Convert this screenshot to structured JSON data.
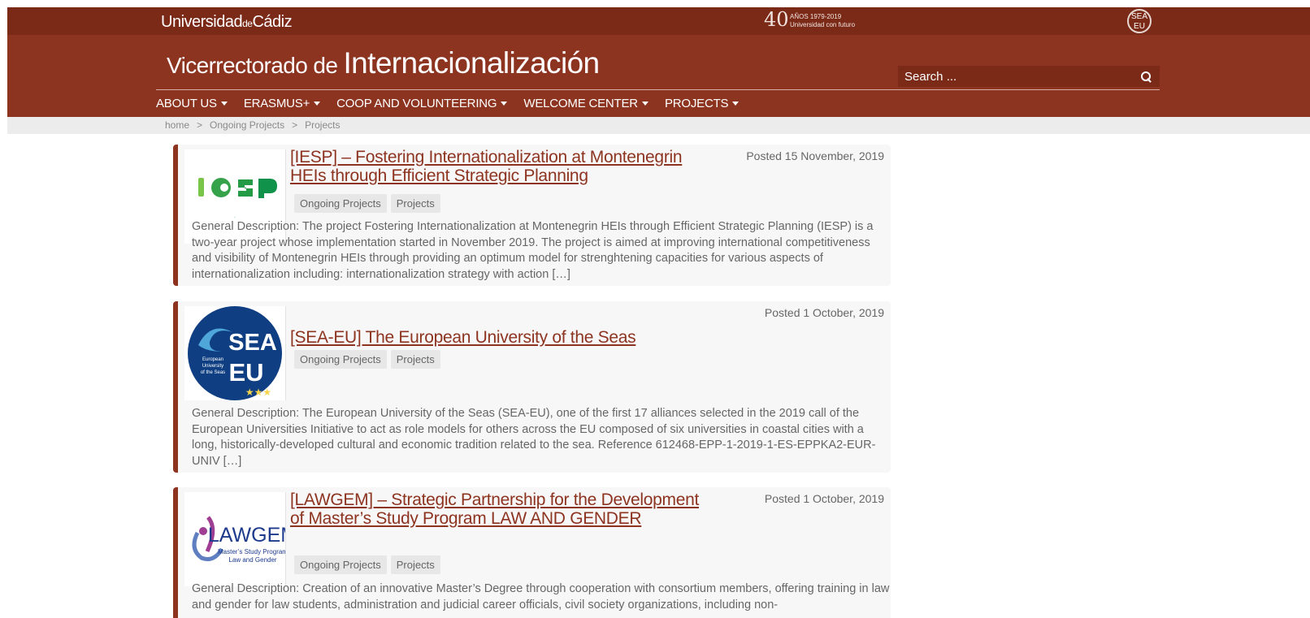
{
  "header": {
    "university_prefix": "Universidad",
    "university_small": "de",
    "university_suffix": "Cádiz",
    "anniversary_number": "40",
    "anniversary_text": "AÑOS 1979-2019 Universidad con futuro",
    "sea_eu_mini": "SEA EU",
    "site_title_small": "Vicerrectorado de ",
    "site_title_large": "Internacionalización",
    "search_placeholder": "Search ..."
  },
  "nav": {
    "items": [
      {
        "label": "ABOUT US"
      },
      {
        "label": "ERASMUS+"
      },
      {
        "label": "COOP AND VOLUNTEERING"
      },
      {
        "label": "WELCOME CENTER"
      },
      {
        "label": "PROJECTS"
      }
    ]
  },
  "breadcrumb": {
    "items": [
      {
        "label": "home"
      },
      {
        "label": "Ongoing Projects"
      },
      {
        "label": "Projects"
      }
    ],
    "separator": ">"
  },
  "posts": [
    {
      "logo_text": "IESP",
      "title": "[IESP] – Fostering Internationalization at Montenegrin HEIs through Efficient Strategic Planning",
      "date": "Posted 15 November, 2019",
      "tags": [
        "Ongoing Projects",
        "Projects"
      ],
      "description": "General Description: The project Fostering Internationalization at Montenegrin HEIs through Efficient Strategic Planning (IESP) is a two-year project whose  implementation started in November 2019. The project is aimed at improving international competitiveness and visibility of Montenegrin HEIs through providing an optimum model for strenghtening capacities for various aspects of internationalization including: internationalization strategy with action […]"
    },
    {
      "logo_text": "SEA EU",
      "logo_caption": "European University of the Seas",
      "title": "[SEA-EU] The European University of the Seas",
      "date": "Posted 1 October, 2019",
      "tags": [
        "Ongoing Projects",
        "Projects"
      ],
      "description": "General Description: The European University of the Seas (SEA-EU), one of the first 17 alliances selected in the 2019 call of the European Universities Initiative to act as role models for others across the EU composed of six universities in coastal cities with a long, historically-developed cultural and economic tradition related to the sea. Reference 612468-EPP-1-2019-1-ES-EPPKA2-EUR-UNIV […]"
    },
    {
      "logo_text": "LAWGEM",
      "logo_caption": "Master’s Study Program Law and Gender",
      "title": "[LAWGEM] – Strategic Partnership for the Development of Master’s Study Program LAW AND GENDER",
      "date": "Posted 1 October, 2019",
      "tags": [
        "Ongoing Projects",
        "Projects"
      ],
      "description": "General Description: Creation of an innovative Master’s Degree through cooperation with consortium members, offering training in law and gender for law students, administration and judicial career officials, civil society organizations, including non-"
    }
  ],
  "colors": {
    "brand": "#8d3420",
    "brand_dark": "#7b2a18",
    "card_background": "#f7f7f7",
    "tag_background": "#e7e7e7"
  }
}
